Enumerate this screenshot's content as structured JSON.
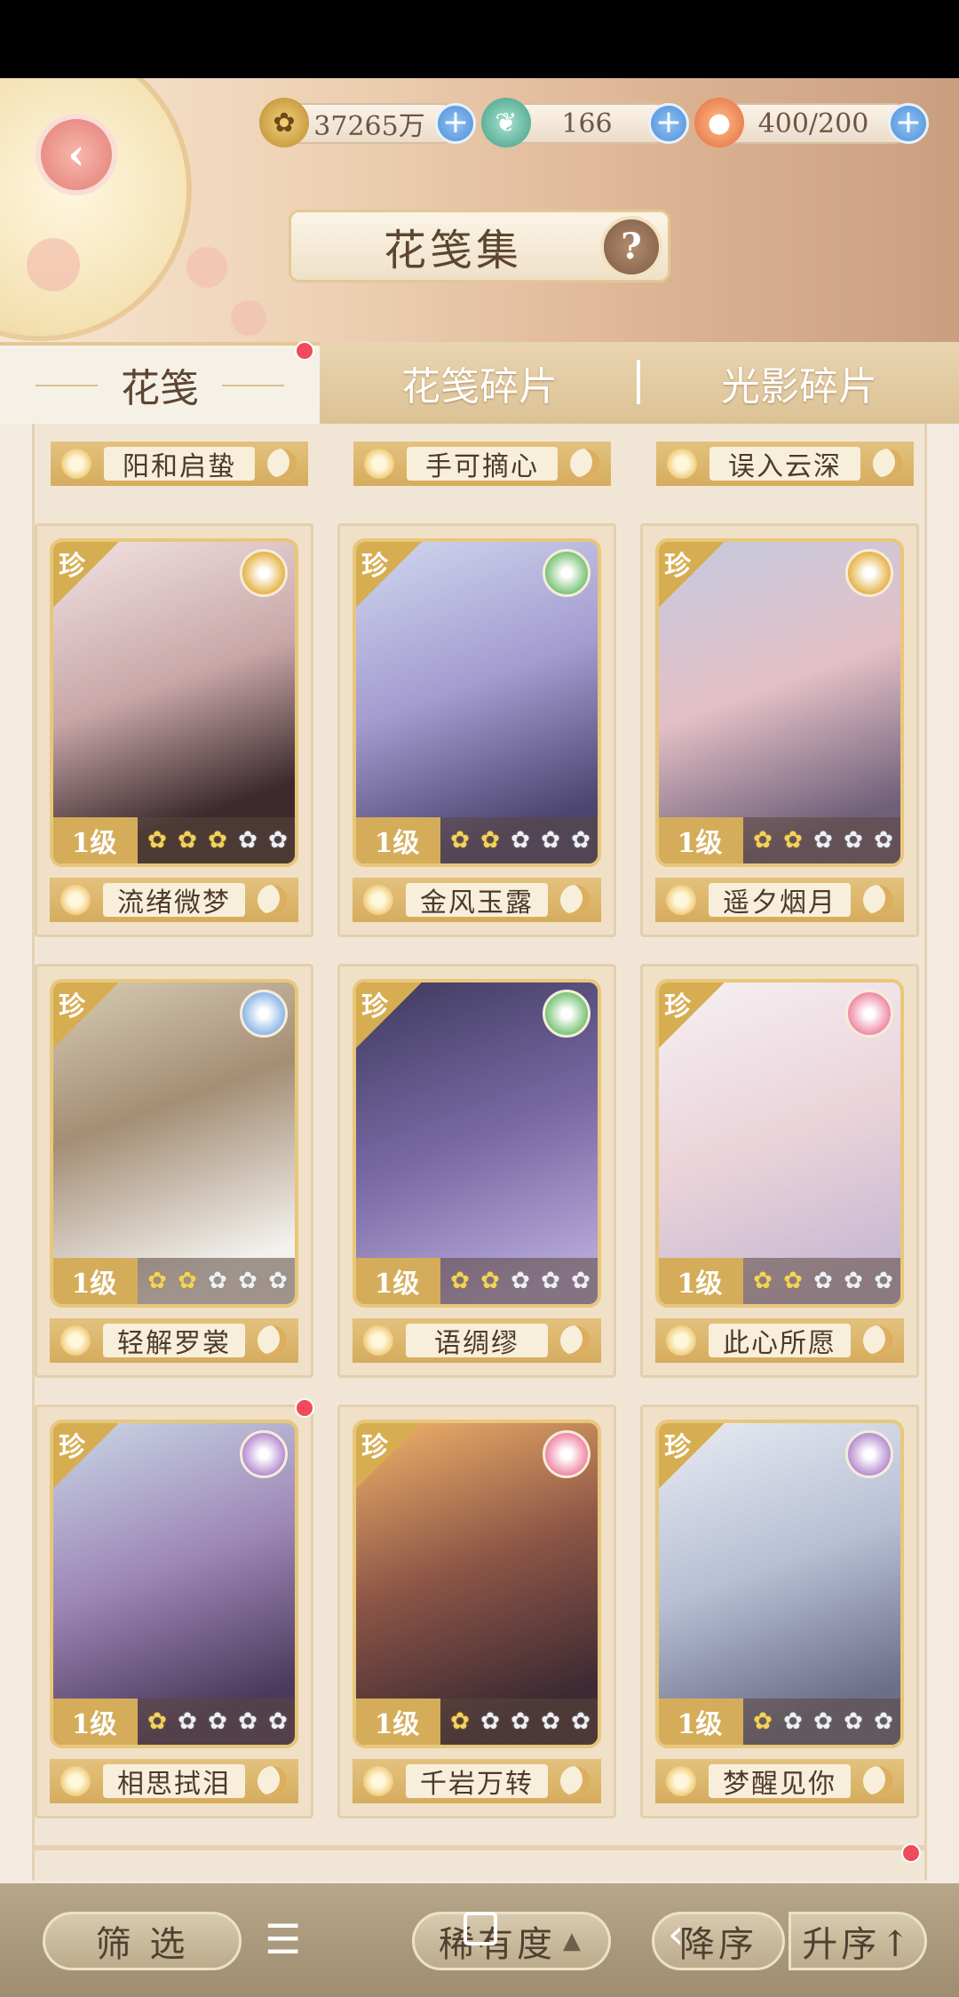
{
  "header": {
    "title": "花笺集",
    "help": "?",
    "back": "‹",
    "currencies": [
      {
        "icon": "paw-coin-icon",
        "value": "37265万"
      },
      {
        "icon": "jade-bird-icon",
        "value": "166"
      },
      {
        "icon": "peach-bun-icon",
        "value": "400/200"
      }
    ]
  },
  "tabs": [
    "花笺",
    "花笺碎片",
    "光影碎片"
  ],
  "partial_row": [
    "阳和启蛰",
    "手可摘心",
    "误入云深"
  ],
  "cards": [
    {
      "rarity": "珍",
      "level": "1级",
      "stars": 3,
      "name": "流绪微梦",
      "attr": "gold",
      "dot": false
    },
    {
      "rarity": "珍",
      "level": "1级",
      "stars": 2,
      "name": "金风玉露",
      "attr": "green",
      "dot": false
    },
    {
      "rarity": "珍",
      "level": "1级",
      "stars": 2,
      "name": "遥夕烟月",
      "attr": "gold",
      "dot": false
    },
    {
      "rarity": "珍",
      "level": "1级",
      "stars": 2,
      "name": "轻解罗裳",
      "attr": "blue",
      "dot": false
    },
    {
      "rarity": "珍",
      "level": "1级",
      "stars": 2,
      "name": "语绸缪",
      "attr": "green",
      "dot": false
    },
    {
      "rarity": "珍",
      "level": "1级",
      "stars": 2,
      "name": "此心所愿",
      "attr": "pink",
      "dot": false
    },
    {
      "rarity": "珍",
      "level": "1级",
      "stars": 1,
      "name": "相思拭泪",
      "attr": "purple",
      "dot": true
    },
    {
      "rarity": "珍",
      "level": "1级",
      "stars": 1,
      "name": "千岩万转",
      "attr": "pink",
      "dot": false
    },
    {
      "rarity": "珍",
      "level": "1级",
      "stars": 1,
      "name": "梦醒见你",
      "attr": "purple",
      "dot": false
    }
  ],
  "bottom": {
    "filter": "筛 选",
    "rarity_sort": "稀有度",
    "desc": "降序",
    "asc": "升序↑"
  },
  "colors": {
    "gold": "#e6b44a",
    "green": "#7cc47a",
    "blue": "#8fb8e8",
    "pink": "#f08aa6",
    "purple": "#b78fd1"
  }
}
